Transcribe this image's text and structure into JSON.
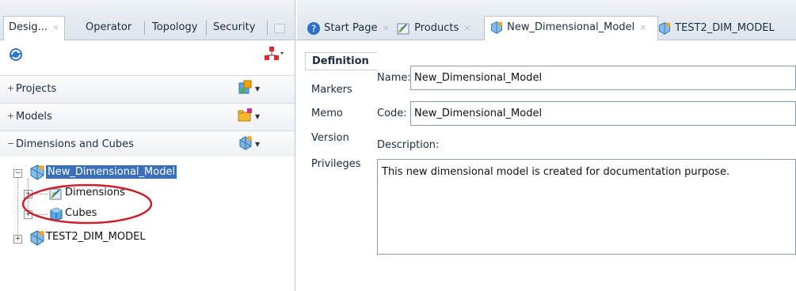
{
  "left_panel": {
    "tabs": [
      {
        "label": "Desig...",
        "close": "×"
      },
      {
        "label": "Operator"
      },
      {
        "label": "Topology"
      },
      {
        "label": "Security"
      }
    ],
    "accordions": [
      {
        "toggle": "+",
        "label": "Projects"
      },
      {
        "toggle": "+",
        "label": "Models"
      },
      {
        "toggle": "−",
        "label": "Dimensions and Cubes"
      }
    ],
    "tree": {
      "root": "New_Dimensional_Model",
      "children": [
        "Dimensions",
        "Cubes"
      ],
      "sibling": "TEST2_DIM_MODEL"
    }
  },
  "editor": {
    "tabs": [
      {
        "label": "Start Page",
        "close": "×"
      },
      {
        "label": "Products",
        "close": "×"
      },
      {
        "label": "New_Dimensional_Model",
        "close": "×"
      },
      {
        "label": "TEST2_DIM_MODEL"
      }
    ],
    "vertical_tabs": [
      "Definition",
      "Markers",
      "Memo",
      "Version",
      "Privileges"
    ],
    "form": {
      "name_label": "Name:",
      "name_value": "New_Dimensional_Model",
      "code_label": "Code:",
      "code_value": "New_Dimensional_Model",
      "description_label": "Description:",
      "description_value": "This new dimensional model is created for documentation purpose."
    }
  },
  "colors": {
    "selection": "#3b6fb8",
    "annotation_ellipse": "#cc1f2a"
  }
}
